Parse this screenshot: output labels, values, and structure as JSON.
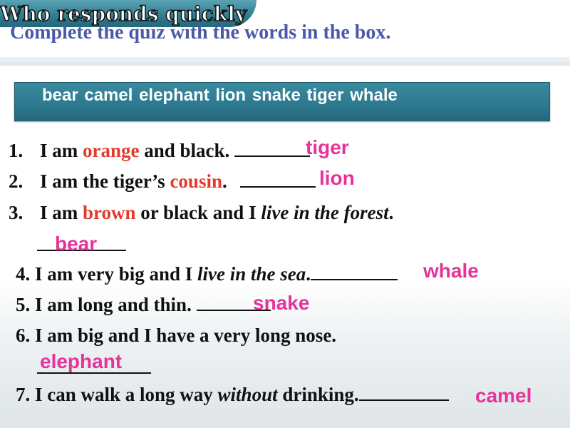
{
  "banner": {
    "label": "Who responds quickly"
  },
  "heading": "Complete the quiz with the words in the box.",
  "word_box": "bear  camel  elephant  lion  snake  tiger   whale",
  "colors": {
    "accent_red": "#e33a2c",
    "answer_pink": "#e6339a",
    "box_teal": "#2e7a90",
    "heading_blue": "#4a5aa8"
  },
  "questions": [
    {
      "num": "1.",
      "pre": "I am ",
      "key": "orange",
      "post": " and black.",
      "answer": "tiger"
    },
    {
      "num": "2.",
      "pre": "I am the tiger’s ",
      "key": "cousin",
      "post": ".",
      "answer": "lion"
    },
    {
      "num": "3.",
      "pre": "I am ",
      "key": "brown",
      "post": " or black and I ",
      "italic": "live in the forest",
      "end": ".",
      "answer": "bear"
    },
    {
      "num": "4.",
      "pre": "I am very big and I ",
      "italic": "live in the sea",
      "end": ".",
      "answer": "whale"
    },
    {
      "num": "5.",
      "text": "I am long and thin.",
      "answer": "snake"
    },
    {
      "num": "6.",
      "text": "I am big and I have a very long nose.",
      "answer": "elephant"
    },
    {
      "num": "7.",
      "pre": "I can walk a long way ",
      "italic": "without",
      "end": " drinking.",
      "answer": "camel"
    }
  ]
}
